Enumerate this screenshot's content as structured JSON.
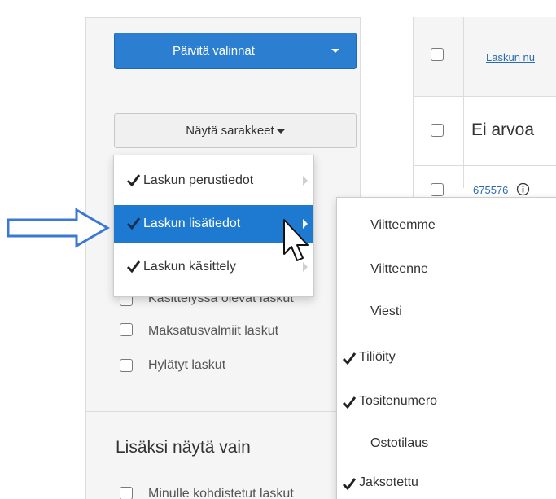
{
  "toolbar": {
    "update_button": "Päivitä valinnat",
    "show_columns_button": "Näytä sarakkeet"
  },
  "filters": {
    "status_items": [
      {
        "label": "Käsittelyssä olevat laskut",
        "checked": false
      },
      {
        "label": "Maksatusvalmiit laskut",
        "checked": false
      },
      {
        "label": "Hylätyt laskut",
        "checked": false
      }
    ],
    "additional_heading": "Lisäksi näytä vain",
    "additional_items": [
      {
        "label": "Minulle kohdistetut laskut",
        "checked": false
      }
    ]
  },
  "table": {
    "header_link": "Laskun nu",
    "group_title": "Ei arvoa",
    "first_row_id": "675576"
  },
  "columns_menu": {
    "items": [
      {
        "label": "Laskun perustiedot",
        "checked": true,
        "active": false
      },
      {
        "label": "Laskun lisätiedot",
        "checked": true,
        "active": true
      },
      {
        "label": "Laskun käsittely",
        "checked": true,
        "active": false
      }
    ]
  },
  "details_submenu": {
    "items": [
      {
        "label": "Viitteemme",
        "checked": false
      },
      {
        "label": "Viitteenne",
        "checked": false
      },
      {
        "label": "Viesti",
        "checked": false
      },
      {
        "label": "Tiliöity",
        "checked": true
      },
      {
        "label": "Tositenumero",
        "checked": true
      },
      {
        "label": "Ostotilaus",
        "checked": false
      },
      {
        "label": "Jaksotettu",
        "checked": true
      }
    ]
  },
  "colors": {
    "primary": "#2c7fd0",
    "active_menu": "#1e7ad0",
    "link": "#2a6ab3",
    "annotation_arrow": "#3b78d6"
  },
  "icons": {
    "check": "check-icon",
    "submenu": "chevron-right-icon",
    "dropdown": "caret-down-icon",
    "info": "info-icon",
    "cursor": "mouse-pointer-icon",
    "annotation": "right-arrow-icon"
  }
}
